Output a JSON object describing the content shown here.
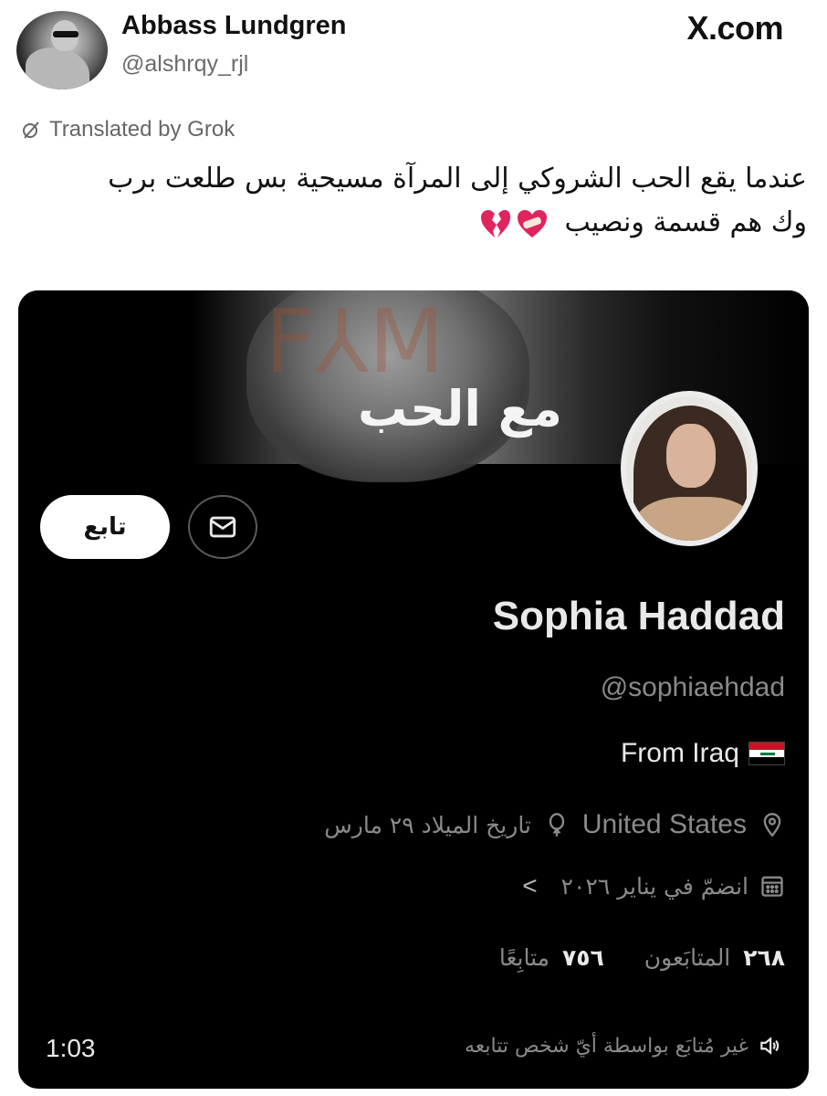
{
  "tweet": {
    "author_name": "Abbass Lundgren",
    "author_handle": "@alshrqy_rjl",
    "site_label": "X.com",
    "translated_label": "Translated by Grok",
    "text_line1": "عندما يقع الحب الشروكي إلى المرآة مسيحية بس طلعت برب",
    "text_line2": "وك هم قسمة ونصيب",
    "emojis": [
      "heart-with-bandage-icon",
      "broken-heart-icon"
    ]
  },
  "profile_card": {
    "banner_title": "مع الحب",
    "follow_label": "تابع",
    "display_name": "Sophia Haddad",
    "handle": "@sophiaehdad",
    "from_label": "From Iraq",
    "location": "United States",
    "birthday": "تاريخ الميلاد ٢٩ مارس",
    "joined": "انضمّ في يناير ٢٠٢٦",
    "followers_count": "٢٦٨",
    "followers_label": "المتابَعون",
    "following_count": "٧٥٦",
    "following_label": "متابِعًا",
    "video_time": "1:03",
    "bottom_note": "غير مُتابَع بواسطة أيّ شخص تتابعه"
  },
  "colors": {
    "card_bg": "#000000",
    "primary_text_dark": "#e9e9e9",
    "secondary_text_dark": "#8a8a8a",
    "follow_button_bg": "#ffffff",
    "heart_red": "#e0245e"
  }
}
